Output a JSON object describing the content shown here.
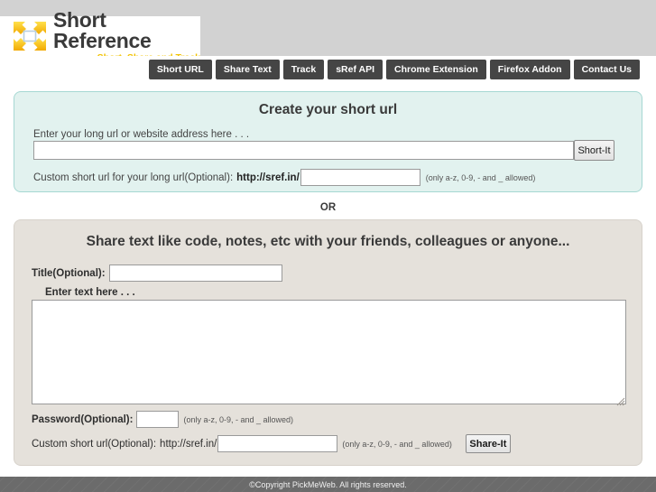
{
  "header": {
    "logo": {
      "icon": "four-arrows-expand-icon",
      "title": "Short Reference",
      "tagline": "Short, Share and Track"
    }
  },
  "nav": {
    "items": [
      {
        "label": "Short URL"
      },
      {
        "label": "Share Text"
      },
      {
        "label": "Track"
      },
      {
        "label": "sRef API"
      },
      {
        "label": "Chrome Extension"
      },
      {
        "label": "Firefox Addon"
      },
      {
        "label": "Contact Us"
      }
    ]
  },
  "short_url_panel": {
    "title": "Create your short url",
    "long_url_label": "Enter your long url or website address here . . .",
    "long_url_value": "",
    "long_url_placeholder": "",
    "submit_label": "Short-It",
    "custom_label": "Custom short url for your long url(Optional):",
    "custom_domain": "http://sref.in/",
    "custom_value": "",
    "custom_placeholder": "",
    "custom_hint": "(only a-z, 0-9, - and _ allowed)"
  },
  "divider": {
    "text": "OR"
  },
  "share_text_panel": {
    "title": "Share text like code, notes, etc with your friends, colleagues or anyone...",
    "title_label": "Title(Optional):",
    "title_value": "",
    "title_placeholder": "",
    "text_label": "Enter text here . . .",
    "text_value": "",
    "text_placeholder": "",
    "password_label": "Password(Optional):",
    "password_value": "",
    "password_hint": "(only a-z, 0-9, - and _ allowed)",
    "custom_label": "Custom short url(Optional):",
    "custom_domain": "http://sref.in/",
    "custom_value": "",
    "custom_hint": "(only a-z, 0-9, - and _ allowed)",
    "submit_label": "Share-It"
  },
  "footer": {
    "copyright": "©Copyright PickMeWeb. All rights reserved."
  },
  "colors": {
    "top_band": "#d2d2d2",
    "nav_button": "#454545",
    "short_panel_bg": "#e2f2ef",
    "short_panel_border": "#a6d8d3",
    "share_panel_bg": "#e5e1db",
    "logo_accent": "#f2c200",
    "footer_bg": "#6b6b6b"
  }
}
